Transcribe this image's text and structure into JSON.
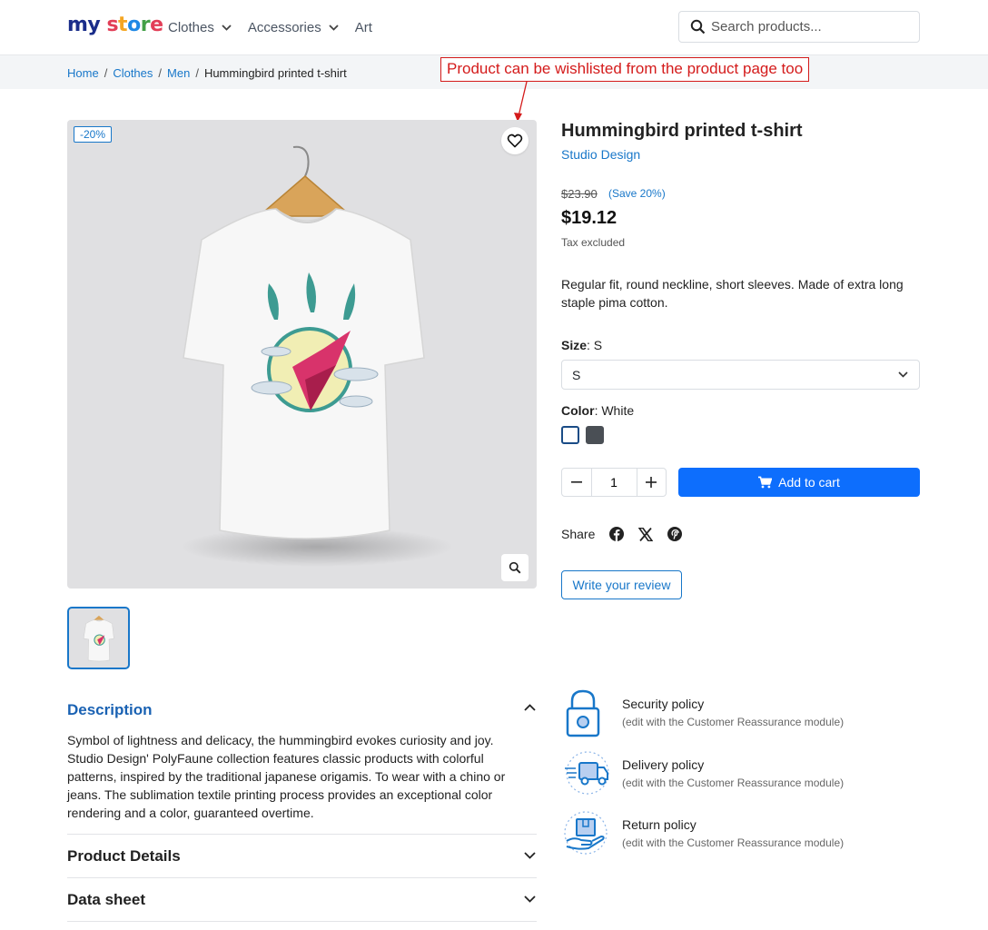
{
  "header": {
    "logo": {
      "my": "my",
      "store": "store"
    },
    "nav": [
      {
        "label": "Clothes",
        "has_dropdown": true
      },
      {
        "label": "Accessories",
        "has_dropdown": true
      },
      {
        "label": "Art",
        "has_dropdown": false
      }
    ],
    "search": {
      "placeholder": "Search products...",
      "icon": "search-icon"
    }
  },
  "breadcrumb": [
    "Home",
    "Clothes",
    "Men",
    "Hummingbird printed t-shirt"
  ],
  "annotation": {
    "text": "Product can be wishlisted from the product page too",
    "color": "#d41b1b"
  },
  "gallery": {
    "discount_badge": "-20%",
    "wishlist_icon": "heart-icon",
    "zoom_icon": "zoom-icon",
    "thumbnails": 1
  },
  "product": {
    "title": "Hummingbird printed t-shirt",
    "brand": "Studio Design",
    "regular_price": "$23.90",
    "save_label": "(Save 20%)",
    "price": "$19.12",
    "tax": "Tax excluded",
    "short_description": "Regular fit, round neckline, short sleeves. Made of extra long staple pima cotton.",
    "size": {
      "label": "Size",
      "value": "S",
      "selected": "S"
    },
    "color": {
      "label": "Color",
      "value": "White",
      "swatches": [
        "#ffffff",
        "#4a4f55"
      ]
    },
    "quantity": "1",
    "add_to_cart": "Add to cart",
    "share_label": "Share",
    "share_icons": [
      "facebook-icon",
      "x-icon",
      "pinterest-icon"
    ],
    "review_button": "Write your review"
  },
  "accordion": {
    "description": {
      "title": "Description",
      "text": "Symbol of lightness and delicacy, the hummingbird evokes curiosity and joy. Studio Design' PolyFaune collection features classic products with colorful patterns, inspired by the traditional japanese origamis. To wear with a chino or jeans. The sublimation textile printing process provides an exceptional color rendering and a color, guaranteed overtime."
    },
    "product_details": {
      "title": "Product Details"
    },
    "data_sheet": {
      "title": "Data sheet"
    }
  },
  "reassurance": [
    {
      "title": "Security policy",
      "subtitle": "(edit with the Customer Reassurance module)",
      "icon": "lock-icon"
    },
    {
      "title": "Delivery policy",
      "subtitle": "(edit with the Customer Reassurance module)",
      "icon": "delivery-truck-icon"
    },
    {
      "title": "Return policy",
      "subtitle": "(edit with the Customer Reassurance module)",
      "icon": "return-box-icon"
    }
  ],
  "colors": {
    "primary": "#0d6efd",
    "link": "#1877c9",
    "annotation": "#d41b1b"
  }
}
